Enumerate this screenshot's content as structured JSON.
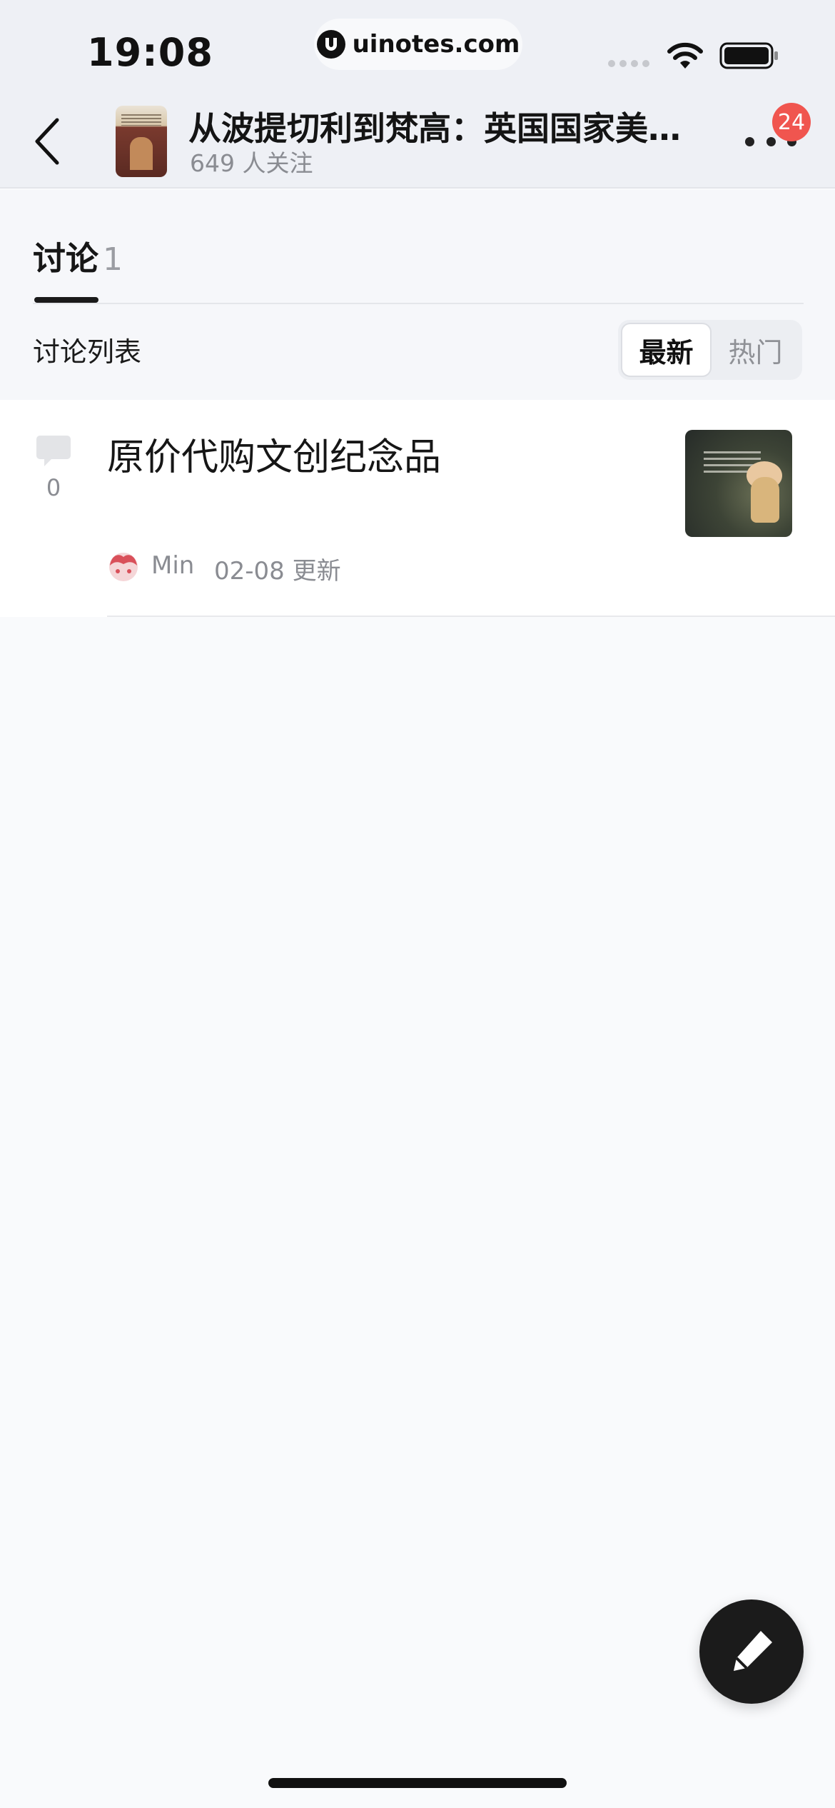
{
  "status_bar": {
    "time": "19:08",
    "url": "uinotes.com",
    "icons": [
      "signal-dots-icon",
      "wifi-icon",
      "battery-icon"
    ]
  },
  "header": {
    "back_icon": "chevron-left-icon",
    "title": "从波提切利到梵高：英国国家美…",
    "followers": "649 人关注",
    "more_icon": "more-dots-icon",
    "badge_count": "24"
  },
  "tabs": [
    {
      "label": "讨论",
      "count": "1",
      "active": true
    }
  ],
  "list": {
    "heading": "讨论列表",
    "sort_options": [
      {
        "label": "最新",
        "active": true
      },
      {
        "label": "热门",
        "active": false
      }
    ]
  },
  "posts": [
    {
      "title": "原价代购文创纪念品",
      "comment_count": "0",
      "author": "Min",
      "updated": "02-08 更新"
    }
  ],
  "compose": {
    "icon": "pen-icon"
  },
  "colors": {
    "badge": "#f0554f",
    "background": "#f9fafc",
    "header_bg": "#eef0f5",
    "compose_bg": "#1b1b1b"
  }
}
